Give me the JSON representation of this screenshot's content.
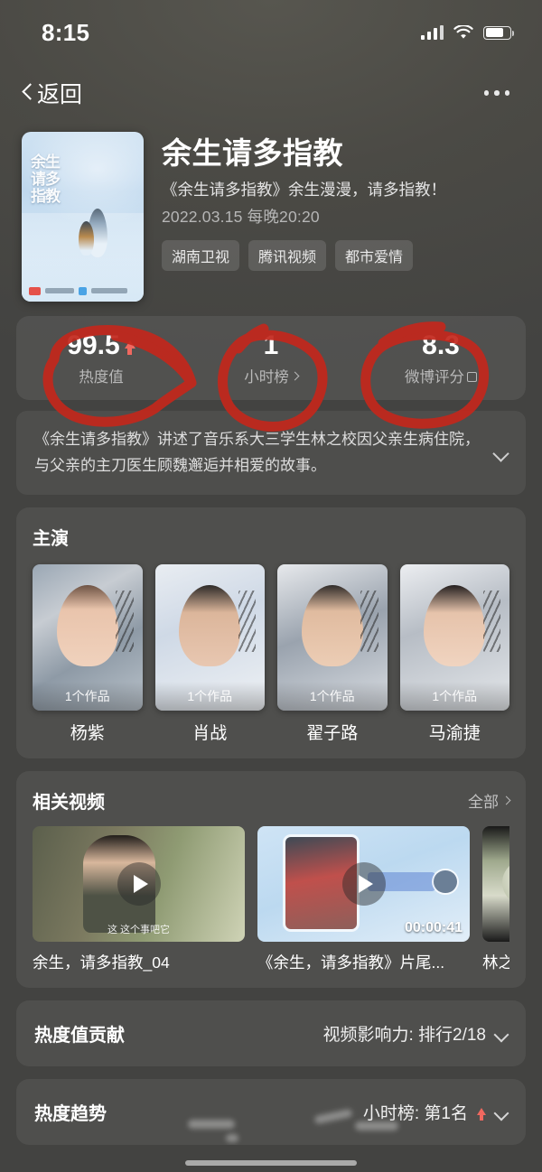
{
  "status_bar": {
    "time": "8:15",
    "icons": [
      "signal-icon",
      "wifi-icon",
      "battery-icon"
    ]
  },
  "nav": {
    "back_label": "返回",
    "more_icon": "more-dots-icon"
  },
  "header": {
    "title": "余生请多指教",
    "subtitle": "《余生请多指教》余生漫漫，请多指教！",
    "date": "2022.03.15 每晚20:20",
    "tags": [
      "湖南卫视",
      "腾讯视频",
      "都市爱情"
    ]
  },
  "stats": [
    {
      "value": "99.5",
      "label": "热度值",
      "trend": "up",
      "chevron": false,
      "external": false
    },
    {
      "value": "1",
      "label": "小时榜",
      "trend": "none",
      "chevron": true,
      "external": false
    },
    {
      "value": "8.3",
      "label": "微博评分",
      "trend": "none",
      "chevron": false,
      "external": true
    }
  ],
  "description": {
    "text": "《余生请多指教》讲述了音乐系大三学生林之校因父亲生病住院，与父亲的主刀医生顾魏邂逅并相爱的故事。",
    "expand_icon": "chevron-down-icon"
  },
  "cast": {
    "title": "主演",
    "items": [
      {
        "name": "杨紫",
        "works": "1个作品"
      },
      {
        "name": "肖战",
        "works": "1个作品"
      },
      {
        "name": "翟子路",
        "works": "1个作品"
      },
      {
        "name": "马渝捷",
        "works": "1个作品"
      }
    ]
  },
  "related_videos": {
    "title": "相关视频",
    "more_label": "全部",
    "items": [
      {
        "title": "余生，请多指教_04",
        "duration": "",
        "caption": "这 这个事吧它"
      },
      {
        "title": "《余生，请多指教》片尾...",
        "duration": "00:00:41",
        "caption": ""
      },
      {
        "title": "林之校",
        "duration": "",
        "caption": ""
      }
    ]
  },
  "contribution_row": {
    "title": "热度值贡献",
    "value": "视频影响力: 排行2/18",
    "expand_icon": "chevron-down-icon"
  },
  "trend_row": {
    "title": "热度趋势",
    "value": "小时榜: 第1名",
    "trend": "up",
    "expand_icon": "chevron-down-icon"
  },
  "colors": {
    "accent_red": "#f0685f",
    "annotation_red": "#c32a20",
    "background": "#4a4a48",
    "card": "rgba(255,255,255,0.07)"
  },
  "annotations": {
    "type": "hand-drawn-red-circles",
    "targets": [
      "热度值",
      "小时榜",
      "微博评分"
    ]
  }
}
